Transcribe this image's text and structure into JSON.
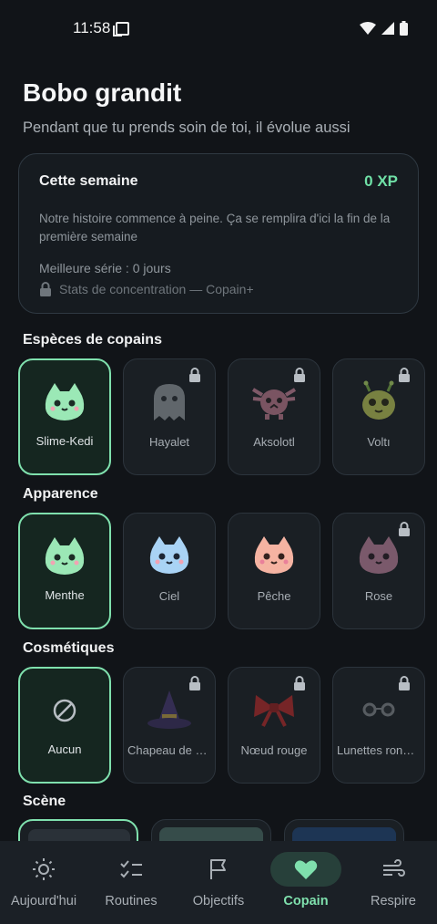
{
  "status_bar": {
    "time": "11:58"
  },
  "header": {
    "title": "Bobo grandit",
    "subtitle": "Pendant que tu prends soin de toi, il évolue aussi"
  },
  "week_card": {
    "title": "Cette semaine",
    "xp": "0 XP",
    "description": "Notre histoire commence à peine. Ça se remplira d'ici la fin de la première semaine",
    "streak": "Meilleure série : 0 jours",
    "locked_stats": "Stats de concentration — Copain+"
  },
  "sections": {
    "species": {
      "title": "Espèces de copains",
      "items": [
        {
          "label": "Slime-Kedi",
          "selected": true,
          "locked": false
        },
        {
          "label": "Hayalet",
          "selected": false,
          "locked": true
        },
        {
          "label": "Aksolotl",
          "selected": false,
          "locked": true
        },
        {
          "label": "Voltı",
          "selected": false,
          "locked": true
        }
      ]
    },
    "appearance": {
      "title": "Apparence",
      "items": [
        {
          "label": "Menthe",
          "selected": true,
          "locked": false,
          "color": "#9be8b6"
        },
        {
          "label": "Ciel",
          "selected": false,
          "locked": false,
          "color": "#a9d3f5"
        },
        {
          "label": "Pêche",
          "selected": false,
          "locked": false,
          "color": "#f5b3a2"
        },
        {
          "label": "Rose",
          "selected": false,
          "locked": true,
          "color": "#b87a95"
        }
      ]
    },
    "cosmetics": {
      "title": "Cosmétiques",
      "items": [
        {
          "label": "Aucun",
          "selected": true,
          "locked": false
        },
        {
          "label": "Chapeau de sorcière",
          "selected": false,
          "locked": true
        },
        {
          "label": "Nœud rouge",
          "selected": false,
          "locked": true
        },
        {
          "label": "Lunettes rondes",
          "selected": false,
          "locked": true
        }
      ]
    },
    "scene": {
      "title": "Scène"
    }
  },
  "bottom_nav": [
    {
      "label": "Aujourd'hui",
      "icon": "sun-icon",
      "active": false
    },
    {
      "label": "Routines",
      "icon": "checklist-icon",
      "active": false
    },
    {
      "label": "Objectifs",
      "icon": "flag-icon",
      "active": false
    },
    {
      "label": "Copain",
      "icon": "heart-icon",
      "active": true
    },
    {
      "label": "Respire",
      "icon": "wind-icon",
      "active": false
    }
  ],
  "colors": {
    "accent": "#7fe0ad",
    "xp": "#6fe0a6",
    "background": "#111418"
  }
}
